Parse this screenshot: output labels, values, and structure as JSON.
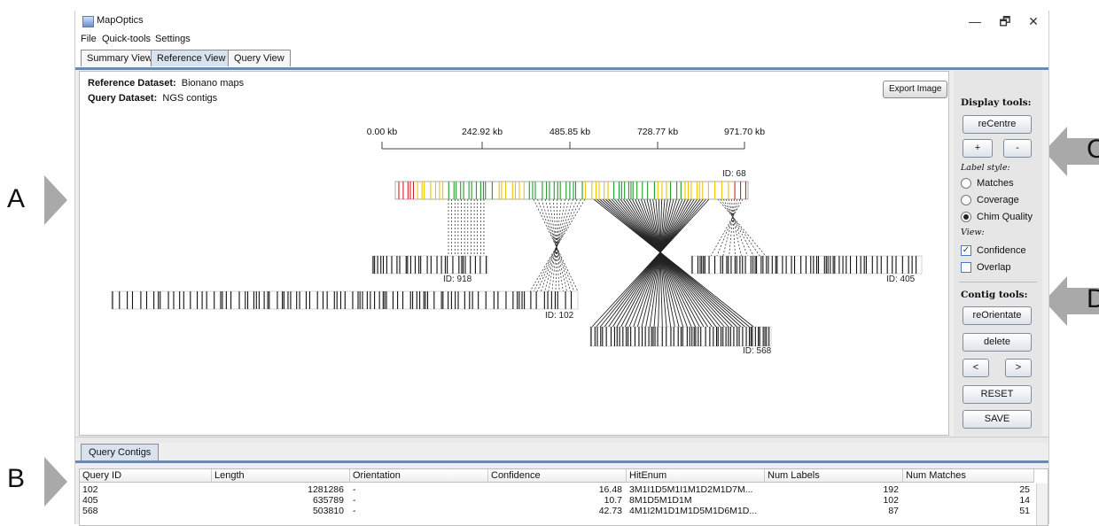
{
  "annotations": {
    "a": "A",
    "b": "B",
    "c": "C",
    "d": "D"
  },
  "window": {
    "title": "MapOptics",
    "minimize": "—",
    "maximize": "🗗",
    "close": "✕"
  },
  "menu": {
    "file": "File",
    "quicktools": "Quick-tools",
    "settings": "Settings"
  },
  "tabs": [
    "Summary View",
    "Reference View",
    "Query View"
  ],
  "viewer": {
    "reference_label": "Reference Dataset:",
    "reference_value": "Bionano maps",
    "query_label": "Query Dataset:",
    "query_value": "NGS contigs",
    "export_button": "Export Image",
    "ruler_ticks": [
      "0.00 kb",
      "242.92 kb",
      "485.85 kb",
      "728.77 kb",
      "971.70 kb"
    ],
    "contig_ids": [
      "ID: 68",
      "ID: 918",
      "ID: 405",
      "ID: 102",
      "ID: 568"
    ]
  },
  "side_panel": {
    "display_tools": "Display tools:",
    "recentre": "reCentre",
    "zoom_in": "+",
    "zoom_out": "-",
    "label_style": "Label style:",
    "label_options": [
      "Matches",
      "Coverage",
      "Chim Quality"
    ],
    "label_selected": "Chim Quality",
    "view_label": "View:",
    "view_options": [
      {
        "label": "Confidence",
        "checked": true
      },
      {
        "label": "Overlap",
        "checked": false
      }
    ],
    "contig_tools": "Contig tools:",
    "reorientate": "reOrientate",
    "delete": "delete",
    "prev": "<",
    "next": ">",
    "reset": "RESET",
    "save": "SAVE"
  },
  "bottom_tab": "Query Contigs",
  "table": {
    "columns": [
      "Query ID",
      "Length",
      "Orientation",
      "Confidence",
      "HitEnum",
      "Num Labels",
      "Num Matches"
    ],
    "rows": [
      [
        "102",
        "1281286",
        "-",
        "16.48",
        "3M1I1D5M1I1M1D2M1D7M...",
        "192",
        "25"
      ],
      [
        "405",
        "635789",
        "-",
        "10.7",
        "8M1D5M1D1M",
        "102",
        "14"
      ],
      [
        "568",
        "503810",
        "-",
        "42.73",
        "4M1I2M1D1M1D5M1D6M1D...",
        "87",
        "51"
      ]
    ]
  },
  "colors": {
    "accent": "#6c89b0",
    "green": "#1f9d2a",
    "yellow": "#f2c200",
    "red": "#d81f26",
    "arrow": "#a9a9a9"
  }
}
